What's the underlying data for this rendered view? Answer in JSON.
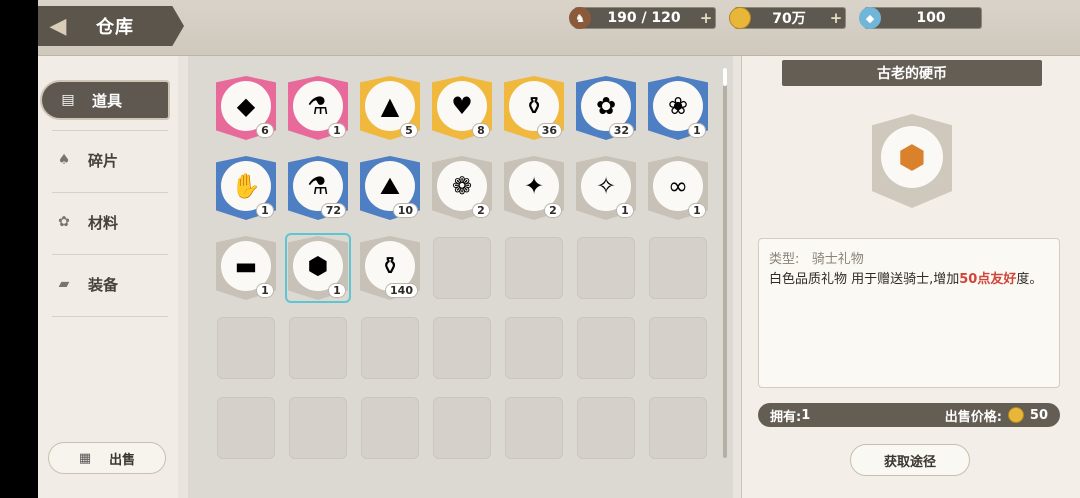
{
  "header": {
    "title": "仓库",
    "stamina": "190 / 120",
    "gold": "70万",
    "gems": "100",
    "plus": "+"
  },
  "sidebar": {
    "items": [
      {
        "label": "道具",
        "icon": "book-icon"
      },
      {
        "label": "碎片",
        "icon": "bell-shard-icon"
      },
      {
        "label": "材料",
        "icon": "gear-material-icon"
      },
      {
        "label": "装备",
        "icon": "equipment-icon"
      }
    ],
    "sell_label": "出售"
  },
  "items": [
    {
      "name": "green-crystal",
      "count": "6",
      "glyph": "◆",
      "color": "#e86a9a"
    },
    {
      "name": "green-potion",
      "count": "1",
      "glyph": "⚗",
      "color": "#e86a9a"
    },
    {
      "name": "blue-prism",
      "count": "5",
      "glyph": "▲",
      "color": "#f0b93e"
    },
    {
      "name": "pink-heart",
      "count": "8",
      "glyph": "♥",
      "color": "#f0b93e"
    },
    {
      "name": "green-vial",
      "count": "36",
      "glyph": "⚱",
      "color": "#f0b93e"
    },
    {
      "name": "ribbon-bow",
      "count": "32",
      "glyph": "✿",
      "color": "#4d7fc2"
    },
    {
      "name": "red-rose",
      "count": "1",
      "glyph": "❀",
      "color": "#4d7fc2"
    },
    {
      "name": "white-gloves",
      "count": "1",
      "glyph": "✋",
      "color": "#4d7fc2"
    },
    {
      "name": "green-bottle",
      "count": "72",
      "glyph": "⚗",
      "color": "#4d7fc2"
    },
    {
      "name": "ore-chunk",
      "count": "10",
      "glyph": "⛰",
      "color": "#4d7fc2"
    },
    {
      "name": "tulip",
      "count": "2",
      "glyph": "❁",
      "color": "#c7c1b7"
    },
    {
      "name": "maple-leaf",
      "count": "2",
      "glyph": "✦",
      "color": "#c7c1b7"
    },
    {
      "name": "candy",
      "count": "1",
      "glyph": "✧",
      "color": "#c7c1b7"
    },
    {
      "name": "band",
      "count": "1",
      "glyph": "∞",
      "color": "#c7c1b7"
    },
    {
      "name": "black-bar",
      "count": "1",
      "glyph": "▬",
      "color": "#c7c1b7"
    },
    {
      "name": "ancient-coin",
      "count": "1",
      "glyph": "⬢",
      "color": "#c7c1b7",
      "selected": true
    },
    {
      "name": "small-bottle",
      "count": "140",
      "glyph": "⚱",
      "color": "#c7c1b7"
    }
  ],
  "detail": {
    "title": "古老的硬币",
    "type_label": "类型:",
    "type_value": "骑士礼物",
    "desc_prefix": "白色品质礼物 用于赠送骑士,增加",
    "desc_highlight": "50点友好",
    "desc_suffix": "度。",
    "own_label": "拥有:",
    "own_value": "1",
    "price_label": "出售价格:",
    "price_value": "50",
    "acquire_label": "获取途径"
  },
  "colors": {
    "accent": "#5f5850",
    "highlight": "#d0453a",
    "selected_outline": "#5ec6d3"
  }
}
